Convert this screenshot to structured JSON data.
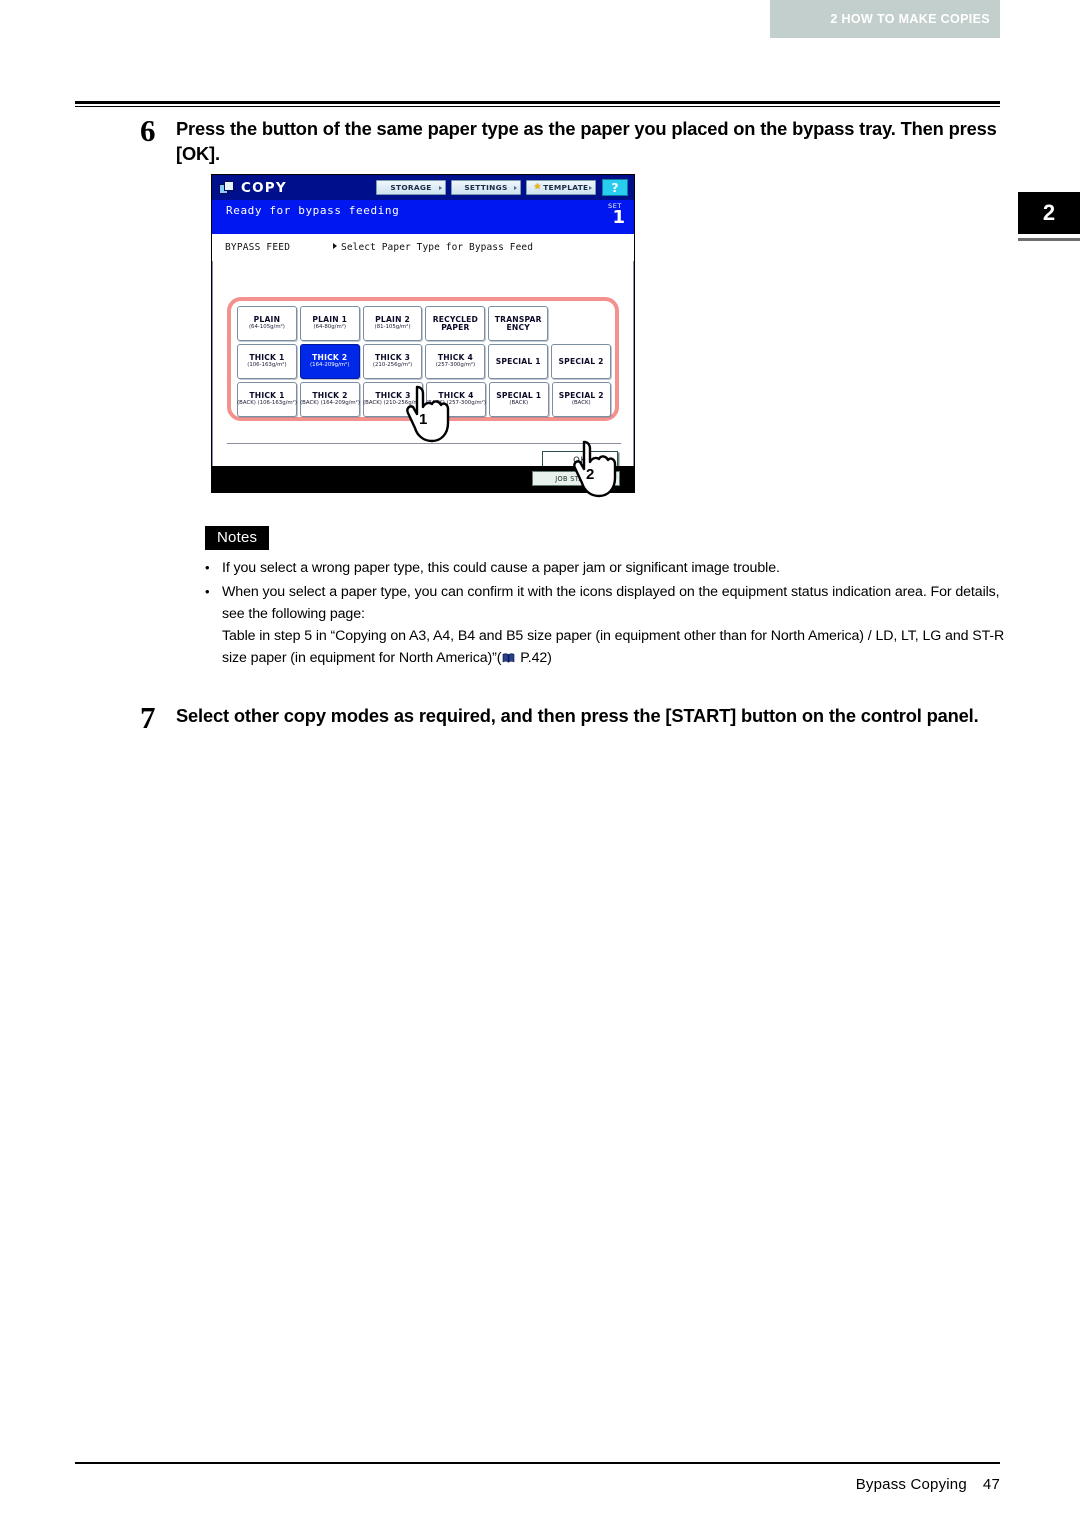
{
  "running_head": "2 HOW TO MAKE COPIES",
  "chapter_tab": "2",
  "steps": [
    {
      "number": "6",
      "text": "Press the button of the same paper type as the paper you placed on the bypass tray. Then press [OK]."
    },
    {
      "number": "7",
      "text": "Select other copy modes as required, and then press the [START] button on the control panel."
    }
  ],
  "lcd": {
    "title": "COPY",
    "toolbar": [
      {
        "label": "STORAGE",
        "has_star": false
      },
      {
        "label": "SETTINGS",
        "has_star": false
      },
      {
        "label": "TEMPLATE",
        "has_star": true
      }
    ],
    "help_label": "?",
    "status_message": "Ready for bypass feeding",
    "set_label": "SET",
    "set_count": "1",
    "mode_label": "BYPASS FEED",
    "prompt": "Select Paper Type for Bypass Feed",
    "paper_rows": [
      [
        {
          "line1": "PLAIN",
          "line2": "(64-105g/m²)",
          "selected": false
        },
        {
          "line1": "PLAIN 1",
          "line2": "(64-80g/m²)",
          "selected": false
        },
        {
          "line1": "PLAIN 2",
          "line2": "(81-105g/m²)",
          "selected": false
        },
        {
          "line1": "RECYCLED",
          "line2": "PAPER",
          "selected": false
        },
        {
          "line1": "TRANSPAR",
          "line2": "ENCY",
          "selected": false
        },
        {
          "line1": "",
          "line2": "",
          "selected": false,
          "empty": true
        }
      ],
      [
        {
          "line1": "THICK 1",
          "line2": "(106-163g/m²)",
          "selected": false
        },
        {
          "line1": "THICK 2",
          "line2": "(164-209g/m²)",
          "selected": true
        },
        {
          "line1": "THICK 3",
          "line2": "(210-256g/m²)",
          "selected": false
        },
        {
          "line1": "THICK 4",
          "line2": "(257-300g/m²)",
          "selected": false
        },
        {
          "line1": "SPECIAL 1",
          "line2": "",
          "selected": false
        },
        {
          "line1": "SPECIAL 2",
          "line2": "",
          "selected": false
        }
      ],
      [
        {
          "line1": "THICK 1",
          "line2": "(BACK) (106-163g/m²)",
          "selected": false
        },
        {
          "line1": "THICK 2",
          "line2": "(BACK) (164-209g/m²)",
          "selected": false
        },
        {
          "line1": "THICK 3",
          "line2": "(BACK) (210-256g/m²)",
          "selected": false
        },
        {
          "line1": "THICK 4",
          "line2": "(BACK) (257-300g/m²)",
          "selected": false
        },
        {
          "line1": "SPECIAL 1",
          "line2": "(BACK)",
          "selected": false
        },
        {
          "line1": "SPECIAL 2",
          "line2": "(BACK)",
          "selected": false
        }
      ]
    ],
    "ok_label": "OK",
    "job_status_label": "JOB STATUS",
    "callout_1": "1",
    "callout_2": "2"
  },
  "notes": {
    "heading": "Notes",
    "bullet": "•",
    "items": [
      "If you select a wrong paper type, this could cause a paper jam or significant image trouble.",
      "When you select a paper type, you can confirm it with the icons displayed on the equipment status indication area. For details, see the following page:",
      "Table in step 5 in “Copying on A3, A4, B4 and B5 size paper (in equipment other than for North America) / LD, LT, LG and ST-R size paper (in equipment for North America)”(",
      " P.42)"
    ]
  },
  "footer": {
    "title": "Bypass Copying",
    "page": "47"
  }
}
